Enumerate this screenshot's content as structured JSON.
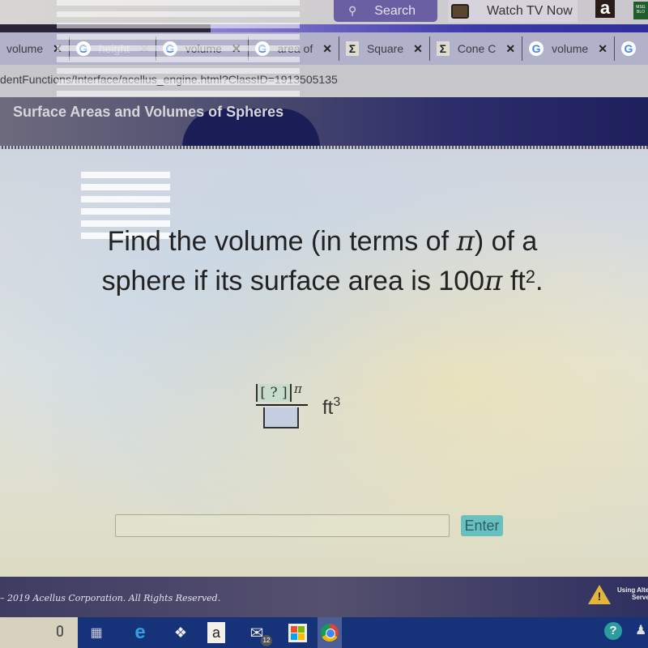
{
  "topbar": {
    "search_label": "Search",
    "watch_tv_label": "Watch TV Now",
    "amazon_icon": "a",
    "msg_icon_text": "MSG BLO"
  },
  "tabs": [
    {
      "label": "volume",
      "icon": "none",
      "faded": false
    },
    {
      "label": "height",
      "icon": "google",
      "faded": true
    },
    {
      "label": "volume",
      "icon": "google",
      "faded": false
    },
    {
      "label": "area of",
      "icon": "google",
      "faded": false
    },
    {
      "label": "Square",
      "icon": "sigma",
      "faded": false
    },
    {
      "label": "Cone C",
      "icon": "sigma",
      "faded": false
    },
    {
      "label": "volume",
      "icon": "google",
      "faded": false
    },
    {
      "label": "",
      "icon": "google",
      "faded": false
    }
  ],
  "tab_close_glyph": "✕",
  "url": "dentFunctions/Interface/acellus_engine.html?ClassID=1913505135",
  "lesson": {
    "title": "Surface Areas and Volumes of Spheres"
  },
  "question": {
    "line1_pre": "Find the volume (in terms of ",
    "pi": "π",
    "line1_post": ") of a",
    "line2_pre": "sphere if its surface area is 100",
    "line2_unit": " ft",
    "line2_exp": "2",
    "line2_end": "."
  },
  "answer": {
    "numerator_placeholder": "[ ? ]",
    "numerator_pi": "π",
    "denominator_value": "",
    "unit": "ft",
    "unit_exp": "3"
  },
  "input": {
    "value": "",
    "placeholder": ""
  },
  "enter_label": "Enter",
  "footer": {
    "copyright": "– 2019 Acellus Corporation. All Rights Reserved.",
    "alt_server_text_1": "Using Alte",
    "alt_server_text_2": "Serve"
  },
  "taskbar": {
    "mail_badge": "12",
    "amazon": "a",
    "help": "?"
  },
  "colors": {
    "enter_button": "#68c1c0",
    "header_bg": "#2c2d6a",
    "warning": "#e4b53a"
  }
}
